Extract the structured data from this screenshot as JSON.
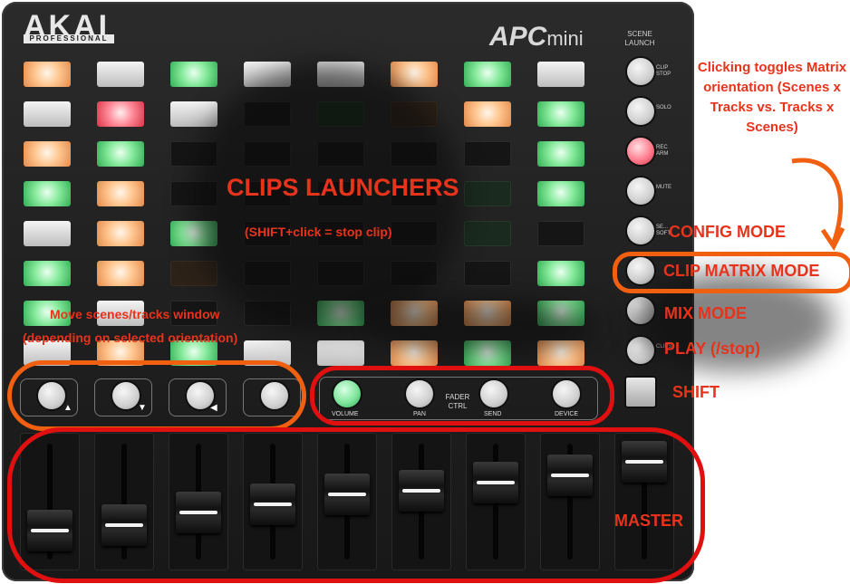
{
  "brand": {
    "name": "AKAI",
    "sub": "PROFESSIONAL",
    "model_prefix": "APC",
    "model_suffix": "mini"
  },
  "scene_launch_title": "SCENE LAUNCH",
  "scene_buttons": [
    {
      "label": "CLIP STOP"
    },
    {
      "label": "SOLO"
    },
    {
      "label": "REC ARM"
    },
    {
      "label": "MUTE"
    },
    {
      "label": "SE... SOFT"
    },
    {
      "label": ""
    },
    {
      "label": ""
    },
    {
      "label": "CLIPS"
    }
  ],
  "pad_grid": [
    [
      "orange",
      "white",
      "green",
      "white",
      "white",
      "orange",
      "green",
      "white"
    ],
    [
      "white",
      "red",
      "white",
      "off",
      "dim-green",
      "dim-orange",
      "orange",
      "green"
    ],
    [
      "orange",
      "green",
      "off",
      "off",
      "off",
      "off",
      "off",
      "green"
    ],
    [
      "green",
      "orange",
      "off",
      "off",
      "off",
      "off",
      "dim-green",
      "green"
    ],
    [
      "white",
      "orange",
      "green",
      "off",
      "off",
      "off",
      "dim-green",
      "off"
    ],
    [
      "green",
      "orange",
      "dim-orange",
      "off",
      "off",
      "off",
      "off",
      "green"
    ],
    [
      "green",
      "white",
      "off",
      "off",
      "green",
      "orange",
      "orange",
      "green"
    ],
    [
      "white",
      "orange",
      "green",
      "white",
      "white",
      "orange",
      "green",
      "orange"
    ]
  ],
  "track_controls": [
    {
      "label": "VOLUME"
    },
    {
      "label": "PAN"
    },
    {
      "label": "SEND"
    },
    {
      "label": "DEVICE"
    }
  ],
  "fader_ctrl_label": "FADER CTRL",
  "faders": [
    {
      "name": "track-1",
      "level": 0.12
    },
    {
      "name": "track-2",
      "level": 0.18
    },
    {
      "name": "track-3",
      "level": 0.34
    },
    {
      "name": "track-4",
      "level": 0.44
    },
    {
      "name": "track-5",
      "level": 0.55
    },
    {
      "name": "track-6",
      "level": 0.6
    },
    {
      "name": "track-7",
      "level": 0.7
    },
    {
      "name": "track-8",
      "level": 0.78
    },
    {
      "name": "master",
      "level": 0.95
    }
  ],
  "annotations": {
    "clips_launchers": "CLIPS LAUNCHERS",
    "shift_click": "(SHIFT+click = stop clip)",
    "orientation_note": "Clicking toggles Matrix orientation (Scenes x Tracks vs. Tracks x Scenes)",
    "config_mode": "CONFIG MODE",
    "clip_matrix_mode": "CLIP MATRIX MODE",
    "mix_mode": "MIX MODE",
    "play": "PLAY (/stop)",
    "shift": "SHIFT",
    "move_window_1": "Move scenes/tracks window",
    "move_window_2": "(depending on selected orientation)",
    "master": "MASTER"
  },
  "colors": {
    "annotation": "#e8331c",
    "ring_red": "#e01010",
    "ring_orange": "#f06010"
  }
}
